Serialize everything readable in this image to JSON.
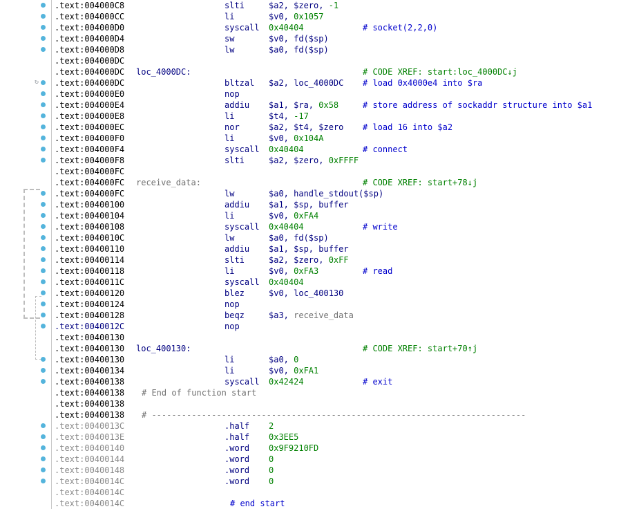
{
  "rows": [
    {
      "addr": ".text:004000C8",
      "mn": "slti",
      "ops": [
        {
          "t": "$a2, $zero, ",
          "c": "ops"
        },
        {
          "t": "-1",
          "c": "num"
        }
      ],
      "dot": true
    },
    {
      "addr": ".text:004000CC",
      "mn": "li",
      "ops": [
        {
          "t": "$v0, ",
          "c": "ops"
        },
        {
          "t": "0x1057",
          "c": "num"
        }
      ],
      "dot": true
    },
    {
      "addr": ".text:004000D0",
      "mn": "syscall",
      "ops": [
        {
          "t": "0x40404",
          "c": "num"
        }
      ],
      "cmt": "# socket(2,2,0)",
      "cmtc": "cmt",
      "dot": true
    },
    {
      "addr": ".text:004000D4",
      "mn": "sw",
      "ops": [
        {
          "t": "$v0, fd($sp)",
          "c": "ops"
        }
      ],
      "dot": true
    },
    {
      "addr": ".text:004000D8",
      "mn": "lw",
      "ops": [
        {
          "t": "$a0, fd($sp)",
          "c": "ops"
        }
      ],
      "dot": true
    },
    {
      "addr": ".text:004000DC"
    },
    {
      "addr": ".text:004000DC",
      "label": "loc_4000DC:",
      "cmt": "# CODE XREF: start:loc_4000DC↓j",
      "cmtc": "cmt-green"
    },
    {
      "addr": ".text:004000DC",
      "mn": "bltzal",
      "ops": [
        {
          "t": "$a2, loc_4000DC",
          "c": "ops"
        }
      ],
      "cmt": "# load 0x4000e4 into $ra",
      "cmtc": "cmt",
      "dot": true,
      "bp": true
    },
    {
      "addr": ".text:004000E0",
      "mn": "nop",
      "dot": true
    },
    {
      "addr": ".text:004000E4",
      "mn": "addiu",
      "ops": [
        {
          "t": "$a1, $ra, ",
          "c": "ops"
        },
        {
          "t": "0x58",
          "c": "num"
        }
      ],
      "cmt": "# store address of sockaddr structure into $a1",
      "cmtc": "cmt",
      "dot": true
    },
    {
      "addr": ".text:004000E8",
      "mn": "li",
      "ops": [
        {
          "t": "$t4, ",
          "c": "ops"
        },
        {
          "t": "-17",
          "c": "num"
        }
      ],
      "dot": true
    },
    {
      "addr": ".text:004000EC",
      "mn": "nor",
      "ops": [
        {
          "t": "$a2, $t4, $zero",
          "c": "ops"
        }
      ],
      "cmt": "# load 16 into $a2",
      "cmtc": "cmt",
      "dot": true
    },
    {
      "addr": ".text:004000F0",
      "mn": "li",
      "ops": [
        {
          "t": "$v0, ",
          "c": "ops"
        },
        {
          "t": "0x104A",
          "c": "num"
        }
      ],
      "dot": true
    },
    {
      "addr": ".text:004000F4",
      "mn": "syscall",
      "ops": [
        {
          "t": "0x40404",
          "c": "num"
        }
      ],
      "cmt": "# connect",
      "cmtc": "cmt",
      "dot": true
    },
    {
      "addr": ".text:004000F8",
      "mn": "slti",
      "ops": [
        {
          "t": "$a2, $zero, ",
          "c": "ops"
        },
        {
          "t": "0xFFFF",
          "c": "num"
        }
      ],
      "dot": true
    },
    {
      "addr": ".text:004000FC"
    },
    {
      "addr": ".text:004000FC",
      "label": "receive_data:",
      "labelc": "label-grey",
      "cmt": "# CODE XREF: start+78↓j",
      "cmtc": "cmt-green"
    },
    {
      "addr": ".text:004000FC",
      "mn": "lw",
      "ops": [
        {
          "t": "$a0, handle_stdout($sp)",
          "c": "ops"
        }
      ],
      "dot": true
    },
    {
      "addr": ".text:00400100",
      "mn": "addiu",
      "ops": [
        {
          "t": "$a1, $sp, buffer",
          "c": "ops"
        }
      ],
      "dot": true
    },
    {
      "addr": ".text:00400104",
      "mn": "li",
      "ops": [
        {
          "t": "$v0, ",
          "c": "ops"
        },
        {
          "t": "0xFA4",
          "c": "num"
        }
      ],
      "dot": true
    },
    {
      "addr": ".text:00400108",
      "mn": "syscall",
      "ops": [
        {
          "t": "0x40404",
          "c": "num"
        }
      ],
      "cmt": "# write",
      "cmtc": "cmt",
      "dot": true
    },
    {
      "addr": ".text:0040010C",
      "mn": "lw",
      "ops": [
        {
          "t": "$a0, fd($sp)",
          "c": "ops"
        }
      ],
      "dot": true
    },
    {
      "addr": ".text:00400110",
      "mn": "addiu",
      "ops": [
        {
          "t": "$a1, $sp, buffer",
          "c": "ops"
        }
      ],
      "dot": true
    },
    {
      "addr": ".text:00400114",
      "mn": "slti",
      "ops": [
        {
          "t": "$a2, $zero, ",
          "c": "ops"
        },
        {
          "t": "0xFF",
          "c": "num"
        }
      ],
      "dot": true
    },
    {
      "addr": ".text:00400118",
      "mn": "li",
      "ops": [
        {
          "t": "$v0, ",
          "c": "ops"
        },
        {
          "t": "0xFA3",
          "c": "num"
        }
      ],
      "cmt": "# read",
      "cmtc": "cmt",
      "dot": true
    },
    {
      "addr": ".text:0040011C",
      "mn": "syscall",
      "ops": [
        {
          "t": "0x40404",
          "c": "num"
        }
      ],
      "dot": true
    },
    {
      "addr": ".text:00400120",
      "mn": "blez",
      "ops": [
        {
          "t": "$v0, loc_400130",
          "c": "ops"
        }
      ],
      "dot": true
    },
    {
      "addr": ".text:00400124",
      "mn": "nop",
      "dot": true
    },
    {
      "addr": ".text:00400128",
      "mn": "beqz",
      "ops": [
        {
          "t": "$a3, ",
          "c": "ops"
        },
        {
          "t": "receive_data",
          "c": "grey"
        }
      ],
      "dot": true
    },
    {
      "addr": ".text:0040012C",
      "addrc": "addr-cur",
      "mn": "nop",
      "dot": true
    },
    {
      "addr": ".text:00400130"
    },
    {
      "addr": ".text:00400130",
      "label": "loc_400130:",
      "cmt": "# CODE XREF: start+70↑j",
      "cmtc": "cmt-green"
    },
    {
      "addr": ".text:00400130",
      "mn": "li",
      "ops": [
        {
          "t": "$a0, ",
          "c": "ops"
        },
        {
          "t": "0",
          "c": "num"
        }
      ],
      "dot": true
    },
    {
      "addr": ".text:00400134",
      "mn": "li",
      "ops": [
        {
          "t": "$v0, ",
          "c": "ops"
        },
        {
          "t": "0xFA1",
          "c": "num"
        }
      ],
      "dot": true
    },
    {
      "addr": ".text:00400138",
      "mn": "syscall",
      "ops": [
        {
          "t": "0x42424",
          "c": "num"
        }
      ],
      "cmt": "# exit",
      "cmtc": "cmt",
      "dot": true
    },
    {
      "addr": ".text:00400138",
      "wide": "# End of function start",
      "widec": "grey"
    },
    {
      "addr": ".text:00400138"
    },
    {
      "addr": ".text:00400138",
      "wide": "# ---------------------------------------------------------------------------",
      "widec": "grey"
    },
    {
      "addr": ".text:0040013C",
      "addrc": "addr-data",
      "mn": ".half",
      "ops": [
        {
          "t": "2",
          "c": "num"
        }
      ],
      "dot": true
    },
    {
      "addr": ".text:0040013E",
      "addrc": "addr-data",
      "mn": ".half",
      "ops": [
        {
          "t": "0x3EE5",
          "c": "num"
        }
      ],
      "dot": true
    },
    {
      "addr": ".text:00400140",
      "addrc": "addr-data",
      "mn": ".word",
      "ops": [
        {
          "t": "0x9F9210FD",
          "c": "num"
        }
      ],
      "dot": true
    },
    {
      "addr": ".text:00400144",
      "addrc": "addr-data",
      "mn": ".word",
      "ops": [
        {
          "t": "0",
          "c": "num"
        }
      ],
      "dot": true
    },
    {
      "addr": ".text:00400148",
      "addrc": "addr-data",
      "mn": ".word",
      "ops": [
        {
          "t": "0",
          "c": "num"
        }
      ],
      "dot": true
    },
    {
      "addr": ".text:0040014C",
      "addrc": "addr-data",
      "mn": ".word",
      "ops": [
        {
          "t": "0",
          "c": "num"
        }
      ],
      "dot": true
    },
    {
      "addr": ".text:0040014C",
      "addrc": "addr-data"
    },
    {
      "addr": ".text:0040014C",
      "addrc": "addr-data",
      "endcmt": "# end start"
    }
  ]
}
